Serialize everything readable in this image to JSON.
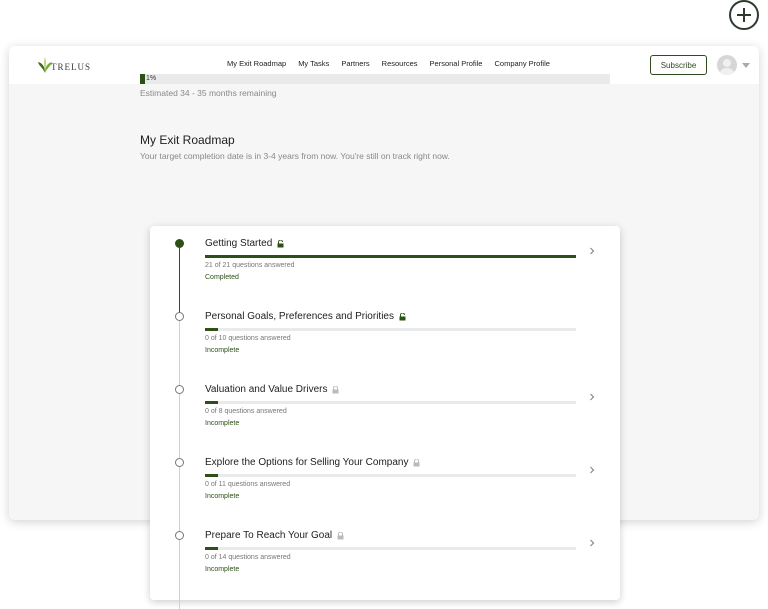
{
  "app": {
    "logo_text": "TRELUS"
  },
  "nav": [
    "My Exit Roadmap",
    "My Tasks",
    "Partners",
    "Resources",
    "Personal Profile",
    "Company Profile"
  ],
  "header": {
    "subscribe_label": "Subscribe"
  },
  "progress": {
    "percent_label": "1%",
    "fraction": 0.01,
    "estimate": "Estimated 34 - 35 months remaining"
  },
  "roadmap": {
    "title": "My Exit Roadmap",
    "subtitle": "Your target completion date is in 3-4 years from now. You're still on track right now."
  },
  "steps": [
    {
      "title": "Getting Started",
      "answered": "21 of 21 questions answered",
      "status": "Completed",
      "progress": 1.0,
      "unlocked": true,
      "has_chevron": true
    },
    {
      "title": "Personal Goals, Preferences and Priorities",
      "answered": "0 of 10 questions answered",
      "status": "Incomplete",
      "progress": 0.035,
      "unlocked": true,
      "has_chevron": false
    },
    {
      "title": "Valuation and Value Drivers",
      "answered": "0 of 8 questions answered",
      "status": "Incomplete",
      "progress": 0.035,
      "unlocked": false,
      "has_chevron": true
    },
    {
      "title": "Explore the Options for Selling Your Company",
      "answered": "0 of 11 questions answered",
      "status": "Incomplete",
      "progress": 0.035,
      "unlocked": false,
      "has_chevron": true
    },
    {
      "title": "Prepare To Reach Your Goal",
      "answered": "0 of 14 questions answered",
      "status": "Incomplete",
      "progress": 0.035,
      "unlocked": false,
      "has_chevron": true
    }
  ],
  "colors": {
    "accent": "#2d5016",
    "track": "#e8eaec"
  }
}
